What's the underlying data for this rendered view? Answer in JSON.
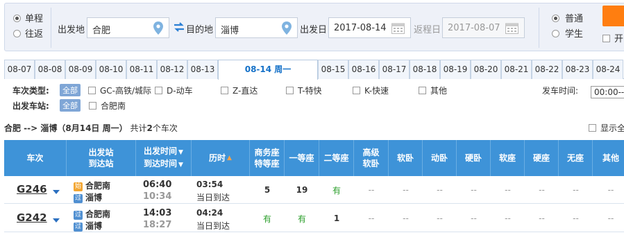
{
  "search": {
    "trip_types": [
      {
        "label": "单程",
        "selected": true
      },
      {
        "label": "往返",
        "selected": false
      }
    ],
    "from_label": "出发地",
    "from_value": "合肥",
    "to_label": "目的地",
    "to_value": "淄博",
    "depart_label": "出发日",
    "depart_value": "2017-08-14",
    "return_label": "返程日",
    "return_value": "2017-08-07",
    "passenger_types": [
      {
        "label": "普通",
        "selected": true
      },
      {
        "label": "学生",
        "selected": false
      }
    ],
    "gaotie_label": "开"
  },
  "date_tabs": [
    {
      "label": "08-07",
      "active": false
    },
    {
      "label": "08-08",
      "active": false
    },
    {
      "label": "08-09",
      "active": false
    },
    {
      "label": "08-10",
      "active": false
    },
    {
      "label": "08-11",
      "active": false
    },
    {
      "label": "08-12",
      "active": false
    },
    {
      "label": "08-13",
      "active": false
    },
    {
      "label": "08-14 周一",
      "active": true
    },
    {
      "label": "08-15",
      "active": false
    },
    {
      "label": "08-16",
      "active": false
    },
    {
      "label": "08-17",
      "active": false
    },
    {
      "label": "08-18",
      "active": false
    },
    {
      "label": "08-19",
      "active": false
    },
    {
      "label": "08-20",
      "active": false
    },
    {
      "label": "08-21",
      "active": false
    },
    {
      "label": "08-22",
      "active": false
    },
    {
      "label": "08-23",
      "active": false
    },
    {
      "label": "08-24",
      "active": false
    }
  ],
  "filters": {
    "train_type_title": "车次类型:",
    "all_label": "全部",
    "train_types": [
      "GC-高铁/城际",
      "D-动车",
      "Z-直达",
      "T-特快",
      "K-快速",
      "其他"
    ],
    "depart_time_title": "发车时间:",
    "depart_time_value": "00:00--",
    "station_title": "出发车站:",
    "stations": [
      "合肥南"
    ]
  },
  "summary": {
    "route": "合肥 --> 淄博（8月14日  周一）",
    "count_prefix": "共计",
    "count": "2",
    "count_suffix": "个车次",
    "show_all_label": "显示全"
  },
  "table": {
    "headers": {
      "train": "车次",
      "station_1": "出发站",
      "station_2": "到达站",
      "time_1": "出发时间",
      "time_2": "到达时间",
      "duration": "历时",
      "business_1": "商务座",
      "business_2": "特等座",
      "first": "一等座",
      "second": "二等座",
      "senior_1": "高级",
      "senior_2": "软卧",
      "soft_sleeper": "软卧",
      "moving_sleeper": "动卧",
      "hard_sleeper": "硬卧",
      "soft_seat": "软座",
      "hard_seat": "硬座",
      "no_seat": "无座",
      "other": "其他"
    },
    "rows": [
      {
        "train_no": "G246",
        "from_badge": "始",
        "from_station": "合肥南",
        "to_badge": "过",
        "to_station": "淄博",
        "depart": "06:40",
        "arrive": "10:34",
        "duration": "03:54",
        "arrival_day": "当日到达",
        "seats": [
          "5",
          "19",
          "有",
          "--",
          "--",
          "--",
          "--",
          "--",
          "--",
          "--",
          "--"
        ]
      },
      {
        "train_no": "G242",
        "from_badge": "过",
        "from_station": "合肥南",
        "to_badge": "过",
        "to_station": "淄博",
        "depart": "14:03",
        "arrive": "18:27",
        "duration": "04:24",
        "arrival_day": "当日到达",
        "seats": [
          "有",
          "有",
          "1",
          "--",
          "--",
          "--",
          "--",
          "--",
          "--",
          "--",
          "--"
        ]
      }
    ]
  },
  "colors": {
    "header_bg": "#3e93d8",
    "accent_orange": "#ff7e10",
    "available_green": "#2c9f2c",
    "link_blue": "#1571c8"
  }
}
